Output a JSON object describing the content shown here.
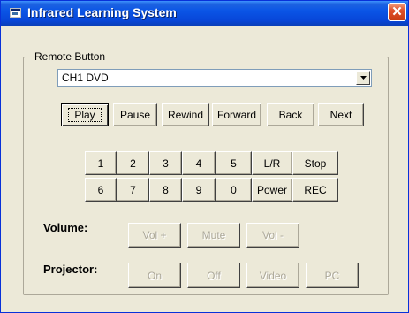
{
  "window": {
    "title": "Infrared Learning System",
    "close_glyph": "✕"
  },
  "remote": {
    "group_label": "Remote Button",
    "selected": "CH1 DVD",
    "transport": [
      "Play",
      "Pause",
      "Rewind",
      "Forward",
      "Back",
      "Next"
    ],
    "keypad_row1": [
      "1",
      "2",
      "3",
      "4",
      "5",
      "L/R",
      "Stop"
    ],
    "keypad_row2": [
      "6",
      "7",
      "8",
      "9",
      "0",
      "Power",
      "REC"
    ]
  },
  "volume": {
    "label": "Volume:",
    "buttons": [
      "Vol +",
      "Mute",
      "Vol -"
    ]
  },
  "projector": {
    "label": "Projector:",
    "buttons": [
      "On",
      "Off",
      "Video",
      "PC"
    ]
  }
}
